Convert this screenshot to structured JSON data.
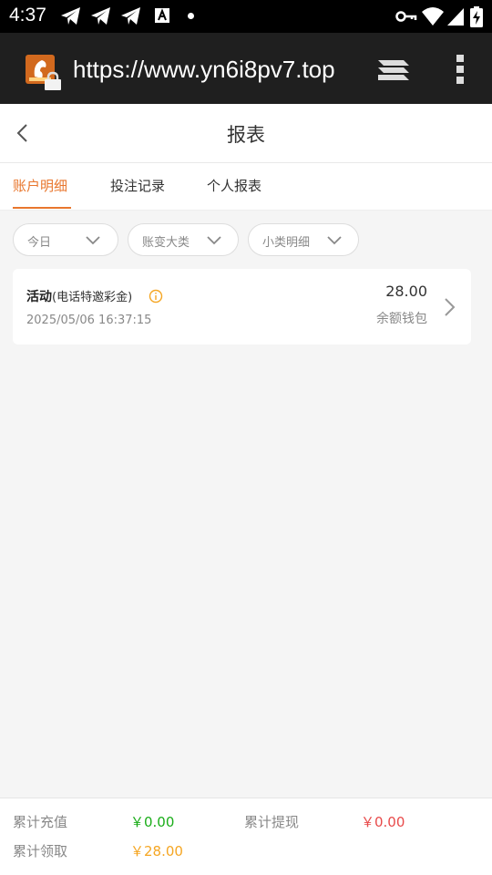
{
  "status_bar": {
    "time": "4:37",
    "icons": [
      "telegram-icon",
      "telegram-icon",
      "telegram-icon",
      "text-a-icon",
      "dot-icon",
      "key-icon",
      "wifi-icon",
      "signal-icon",
      "battery-charging-icon"
    ]
  },
  "browser": {
    "url": "https://www.yn6i8pv7.top",
    "icons": [
      "site-logo",
      "lock-icon",
      "tabs-icon",
      "menu-icon"
    ]
  },
  "header": {
    "title": "报表",
    "back_icon": "chevron-left-icon"
  },
  "tabs": [
    {
      "label": "账户明细",
      "active": true
    },
    {
      "label": "投注记录",
      "active": false
    },
    {
      "label": "个人报表",
      "active": false
    }
  ],
  "filters": [
    {
      "label": "今日"
    },
    {
      "label": "账变大类"
    },
    {
      "label": "小类明细"
    }
  ],
  "records": [
    {
      "title": "活动",
      "subtitle": "(电话特邀彩金)",
      "date": "2025/05/06 16:37:15",
      "amount": "28.00",
      "wallet": "余额钱包"
    }
  ],
  "summary": {
    "deposit_label": "累计充值",
    "deposit_value": "￥0.00",
    "withdraw_label": "累计提现",
    "withdraw_value": "￥0.00",
    "claim_label": "累计领取",
    "claim_value": "￥28.00"
  },
  "colors": {
    "accent": "#e8762d",
    "green": "#1aad19",
    "red": "#e84a4a",
    "orange": "#f5a623"
  }
}
